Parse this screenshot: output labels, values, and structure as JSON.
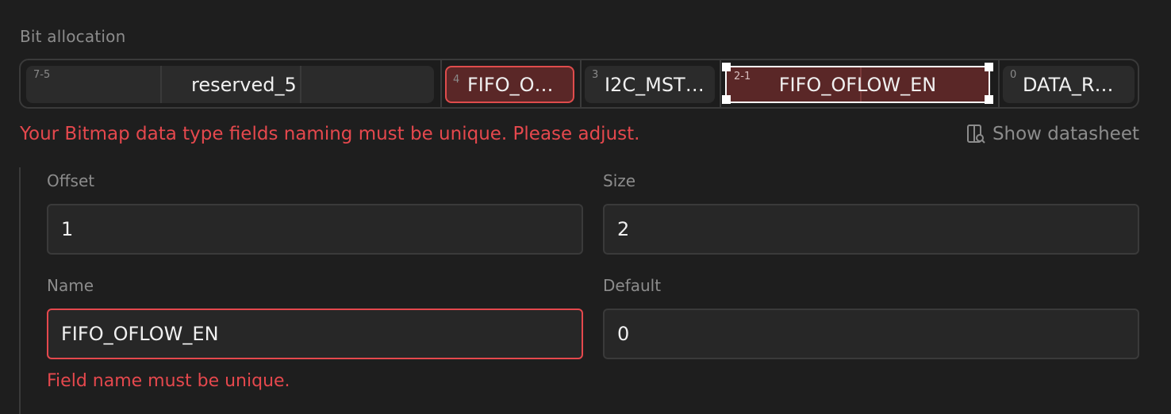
{
  "section_label": "Bit allocation",
  "bit_segments": [
    {
      "range": "7-5",
      "label": "reserved_5"
    },
    {
      "range": "4",
      "label": "FIFO_OF…"
    },
    {
      "range": "3",
      "label": "I2C_MST…"
    },
    {
      "range": "2-1",
      "label": "FIFO_OFLOW_EN"
    },
    {
      "range": "0",
      "label": "DATA_R…"
    }
  ],
  "error_message": "Your Bitmap data type fields naming must be unique. Please adjust.",
  "show_datasheet_label": "Show datasheet",
  "fields": {
    "offset": {
      "label": "Offset",
      "value": "1"
    },
    "size": {
      "label": "Size",
      "value": "2"
    },
    "name": {
      "label": "Name",
      "value": "FIFO_OFLOW_EN",
      "error": "Field name must be unique."
    },
    "default": {
      "label": "Default",
      "value": "0"
    }
  },
  "colors": {
    "error": "#e5484d",
    "selected_segment": "#5a2727",
    "background": "#1e1e1e"
  }
}
